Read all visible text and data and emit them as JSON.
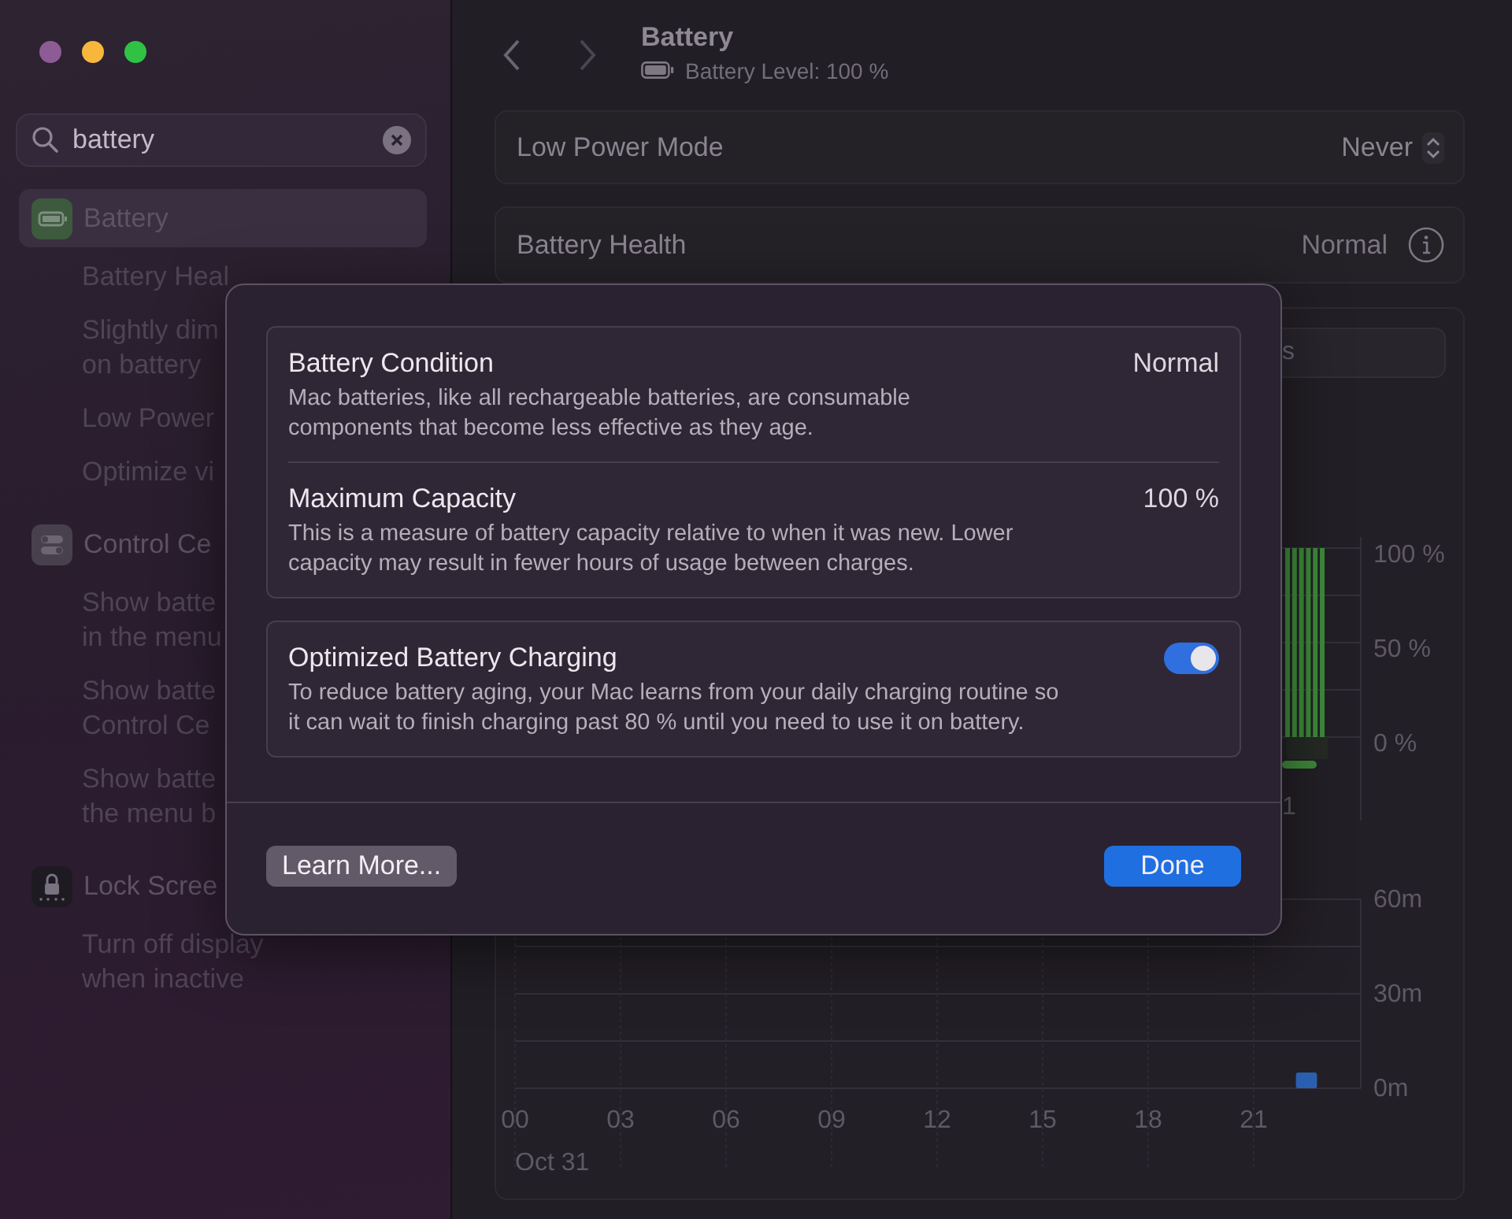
{
  "sidebar": {
    "search": {
      "value": "battery"
    },
    "sections": [
      {
        "title": "Battery",
        "selected": true,
        "children": [
          {
            "lines": [
              "Battery Heal"
            ],
            "selected": false
          },
          {
            "lines": [
              "Slightly dim",
              "on battery"
            ],
            "selected": false
          },
          {
            "lines": [
              "Low Power"
            ],
            "selected": false
          },
          {
            "lines": [
              "Optimize vi"
            ],
            "selected": false
          }
        ]
      },
      {
        "title": "Control Ce",
        "selected": false,
        "children": [
          {
            "lines": [
              "Show batte",
              "in the menu"
            ],
            "selected": false
          },
          {
            "lines": [
              "Show batte",
              "Control Ce"
            ],
            "selected": false
          },
          {
            "lines": [
              "Show batte",
              "the menu b"
            ],
            "selected": false
          }
        ]
      },
      {
        "title": "Lock Scree",
        "selected": false,
        "children": [
          {
            "lines": [
              "Turn off display",
              "when inactive"
            ],
            "selected": false
          }
        ]
      }
    ]
  },
  "header": {
    "title": "Battery",
    "subtitle": "Battery Level: 100 %"
  },
  "settings": [
    {
      "kind": "popup",
      "label": "Low Power Mode",
      "value": "Never"
    },
    {
      "kind": "info",
      "label": "Battery Health",
      "value": "Normal"
    }
  ],
  "segmented_control": {
    "visible_text": "s"
  },
  "level_chart": {
    "ytick_labels": [
      "100 %",
      "50 %",
      "0 %"
    ],
    "xtick_label": "1"
  },
  "usage_chart": {
    "chart_data": {
      "type": "bar",
      "xlabel": "Oct 31",
      "x": [
        22.5
      ],
      "series": [
        {
          "color": "#2a5fb0",
          "values": [
            5
          ]
        }
      ],
      "xlim": [
        0,
        24
      ],
      "ylim": [
        0,
        60
      ],
      "xticks": [
        {
          "value": 0,
          "label": "00"
        },
        {
          "value": 3,
          "label": "03"
        },
        {
          "value": 6,
          "label": "06"
        },
        {
          "value": 9,
          "label": "09"
        },
        {
          "value": 12,
          "label": "12"
        },
        {
          "value": 15,
          "label": "15"
        },
        {
          "value": 18,
          "label": "18"
        },
        {
          "value": 21,
          "label": "21"
        }
      ],
      "yticks": [
        {
          "value": 0,
          "label": "0m"
        },
        {
          "value": 30,
          "label": "30m"
        },
        {
          "value": 60,
          "label": "60m"
        }
      ]
    }
  },
  "modal": {
    "groups": [
      {
        "items": [
          {
            "kind": "value",
            "title": "Battery Condition",
            "value": "Normal",
            "description_lines": [
              "Mac batteries, like all rechargeable batteries, are consumable",
              "components that become less effective as they age."
            ]
          },
          {
            "kind": "value",
            "title": "Maximum Capacity",
            "value": "100 %",
            "description_lines": [
              "This is a measure of battery capacity relative to when it was new. Lower",
              "capacity may result in fewer hours of usage between charges."
            ]
          }
        ]
      },
      {
        "items": [
          {
            "kind": "toggle",
            "title": "Optimized Battery Charging",
            "on": true,
            "description_lines": [
              "To reduce battery aging, your Mac learns from your daily charging routine so",
              "it can wait to finish charging past 80 % until you need to use it on battery."
            ]
          }
        ]
      }
    ],
    "buttons": [
      {
        "kind": "secondary",
        "label": "Learn More..."
      },
      {
        "kind": "primary",
        "label": "Done"
      }
    ]
  }
}
